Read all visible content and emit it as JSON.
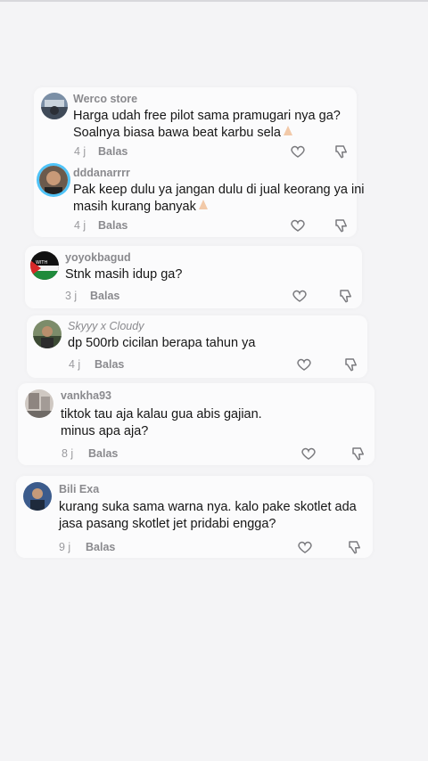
{
  "comments": [
    {
      "username": "Werco store",
      "line1": "Harga udah free pilot sama pramugari nya ga?",
      "line2": "Soalnya biasa bawa beat karbu sela",
      "time": "4 j",
      "reply": "Balas"
    },
    {
      "username": "dddanarrrr",
      "line1": "Pak keep dulu ya jangan dulu di jual keorang ya ini",
      "line2": "masih kurang banyak",
      "time": "4 j",
      "reply": "Balas"
    },
    {
      "username": "yoyokbagud",
      "line1": "Stnk masih idup ga?",
      "time": "3 j",
      "reply": "Balas",
      "avatar_text": "WITH"
    },
    {
      "username": "Skyyy x Cloudy",
      "line1": "dp 500rb cicilan berapa tahun ya",
      "time": "4 j",
      "reply": "Balas"
    },
    {
      "username": "vankha93",
      "line1": "tiktok tau aja kalau gua abis gajian.",
      "line2": "minus apa aja?",
      "time": "8 j",
      "reply": "Balas"
    },
    {
      "username": "Bili Exa",
      "line1": "kurang suka sama warna nya. kalo pake skotlet ada",
      "line2": "jasa pasang skotlet jet pridabi engga?",
      "time": "9 j",
      "reply": "Balas"
    }
  ],
  "colors": {
    "background": "#f4f4f6",
    "card": "#fbfbfc",
    "username": "#8a8a8e",
    "text": "#161616"
  }
}
